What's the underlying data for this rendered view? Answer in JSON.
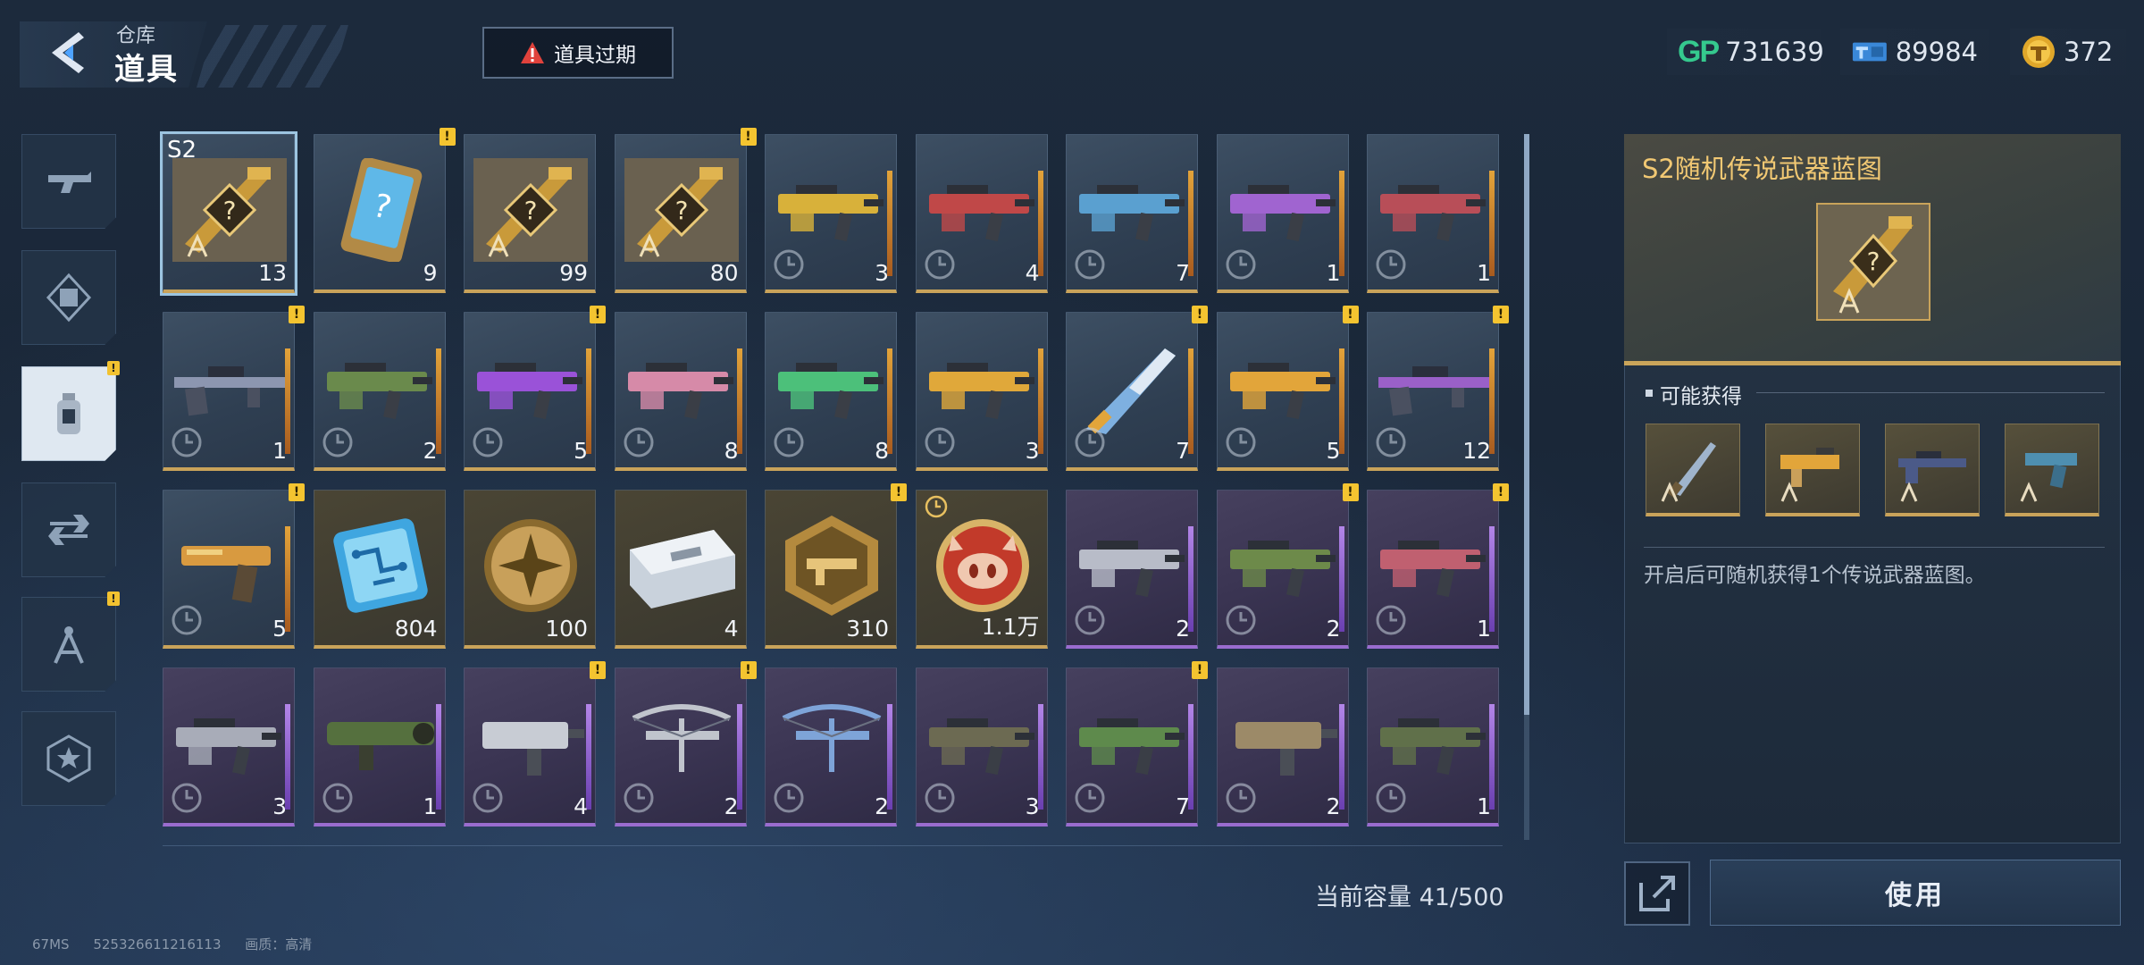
{
  "header": {
    "breadcrumb_parent": "仓库",
    "title": "道具",
    "expire_button": "道具过期"
  },
  "currencies": [
    {
      "icon": "gp-icon",
      "value": "731639"
    },
    {
      "icon": "ticket-icon",
      "value": "89984"
    },
    {
      "icon": "coin-icon",
      "value": "372"
    }
  ],
  "categories": [
    {
      "icon": "gun-icon",
      "active": false,
      "badge": false
    },
    {
      "icon": "frame-icon",
      "active": false,
      "badge": false
    },
    {
      "icon": "item-bottle-icon",
      "active": true,
      "badge": true
    },
    {
      "icon": "exchange-icon",
      "active": false,
      "badge": false
    },
    {
      "icon": "blueprint-compass-icon",
      "active": false,
      "badge": true
    },
    {
      "icon": "star-badge-icon",
      "active": false,
      "badge": false
    }
  ],
  "grid": {
    "selected_tag": "S2",
    "items": [
      {
        "qty": "13",
        "kind": "blueprint",
        "rarity": "gold",
        "badge": false,
        "selected": true
      },
      {
        "qty": "9",
        "kind": "card",
        "rarity": "gold",
        "badge": true
      },
      {
        "qty": "99",
        "kind": "blueprint",
        "rarity": "gold",
        "badge": false
      },
      {
        "qty": "80",
        "kind": "blueprint",
        "rarity": "gold",
        "badge": true
      },
      {
        "qty": "3",
        "kind": "rifle",
        "rarity": "gold",
        "badge": false,
        "color": "#d8b13a"
      },
      {
        "qty": "4",
        "kind": "rifle",
        "rarity": "gold",
        "badge": false,
        "color": "#c04848"
      },
      {
        "qty": "7",
        "kind": "rifle",
        "rarity": "gold",
        "badge": false,
        "color": "#5aa0d0"
      },
      {
        "qty": "1",
        "kind": "rifle",
        "rarity": "gold",
        "badge": false,
        "color": "#a064d0"
      },
      {
        "qty": "1",
        "kind": "rifle",
        "rarity": "gold",
        "badge": false,
        "color": "#b84e58"
      },
      {
        "qty": "1",
        "kind": "sniper",
        "rarity": "gold",
        "badge": true,
        "color": "#8c96b0"
      },
      {
        "qty": "2",
        "kind": "rifle",
        "rarity": "gold",
        "badge": false,
        "color": "#6a8a4c"
      },
      {
        "qty": "5",
        "kind": "rifle",
        "rarity": "gold",
        "badge": true,
        "color": "#9a52d8"
      },
      {
        "qty": "8",
        "kind": "rifle",
        "rarity": "gold",
        "badge": false,
        "color": "#d68aa8"
      },
      {
        "qty": "8",
        "kind": "rifle",
        "rarity": "gold",
        "badge": false,
        "color": "#4cc07a"
      },
      {
        "qty": "3",
        "kind": "rifle",
        "rarity": "gold",
        "badge": false,
        "color": "#e0a83a"
      },
      {
        "qty": "7",
        "kind": "knife",
        "rarity": "gold",
        "badge": true,
        "color": "#7eb0e0"
      },
      {
        "qty": "5",
        "kind": "rifle",
        "rarity": "gold",
        "badge": true,
        "color": "#e2a53a"
      },
      {
        "qty": "12",
        "kind": "sniper",
        "rarity": "gold",
        "badge": true,
        "color": "#9a60c8"
      },
      {
        "qty": "5",
        "kind": "pistol",
        "rarity": "gold",
        "badge": true,
        "color": "#d89a40"
      },
      {
        "qty": "804",
        "kind": "chip",
        "rarity": "gold",
        "badge": false
      },
      {
        "qty": "100",
        "kind": "gold-coin",
        "rarity": "gold",
        "badge": false
      },
      {
        "qty": "4",
        "kind": "case",
        "rarity": "gold",
        "badge": false
      },
      {
        "qty": "310",
        "kind": "hex-emblem",
        "rarity": "gold",
        "badge": true
      },
      {
        "qty": "1.1万",
        "kind": "pig-coin",
        "rarity": "gold",
        "badge": false,
        "timer": true
      },
      {
        "qty": "2",
        "kind": "rifle",
        "rarity": "purple",
        "badge": false,
        "color": "#b8bcc8"
      },
      {
        "qty": "2",
        "kind": "rifle",
        "rarity": "purple",
        "badge": true,
        "color": "#6d8a4a"
      },
      {
        "qty": "1",
        "kind": "rifle",
        "rarity": "purple",
        "badge": true,
        "color": "#c06070"
      },
      {
        "qty": "3",
        "kind": "rifle",
        "rarity": "purple",
        "badge": false,
        "color": "#a8acb8"
      },
      {
        "qty": "1",
        "kind": "launcher",
        "rarity": "purple",
        "badge": false,
        "color": "#55703e"
      },
      {
        "qty": "4",
        "kind": "smg",
        "rarity": "purple",
        "badge": true,
        "color": "#c8ccd4"
      },
      {
        "qty": "2",
        "kind": "crossbow",
        "rarity": "purple",
        "badge": true,
        "color": "#c0c4cc"
      },
      {
        "qty": "2",
        "kind": "crossbow",
        "rarity": "purple",
        "badge": false,
        "color": "#7ea4d8"
      },
      {
        "qty": "3",
        "kind": "rifle",
        "rarity": "purple",
        "badge": false,
        "color": "#6c6a52"
      },
      {
        "qty": "7",
        "kind": "rifle",
        "rarity": "purple",
        "badge": true,
        "color": "#5e8a4c"
      },
      {
        "qty": "2",
        "kind": "smg",
        "rarity": "purple",
        "badge": false,
        "color": "#9c8a68"
      },
      {
        "qty": "1",
        "kind": "rifle",
        "rarity": "purple",
        "badge": false,
        "color": "#60704a"
      }
    ],
    "capacity": "当前容量 41/500"
  },
  "detail": {
    "title": "S2随机传说武器蓝图",
    "obtain_title": "可能获得",
    "rewards": [
      "knife-blueprint",
      "rifle-gold-blueprint",
      "sniper-blueprint",
      "pistol-blueprint"
    ],
    "description": "开启后可随机获得1个传说武器蓝图。",
    "use_button": "使用"
  },
  "footer": {
    "latency": "67MS",
    "id": "525326611216113",
    "quality": "画质：高清"
  },
  "colors": {
    "gold": "#c9a35a",
    "purple": "#9a6ccf",
    "title_gold": "#f1c873",
    "badge": "#f4c430"
  }
}
